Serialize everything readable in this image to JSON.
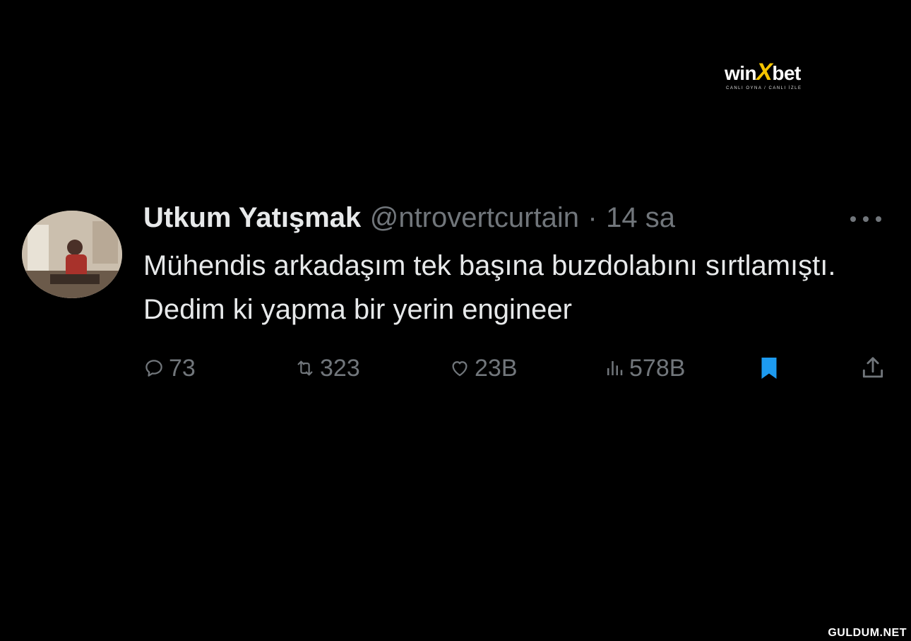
{
  "brand": {
    "logo_text": "winxbet",
    "tagline": "CANLI OYNA / CANLI İZLE"
  },
  "tweet": {
    "display_name": "Utkum Yatışmak",
    "handle": "@ntrovertcurtain",
    "separator": "·",
    "time": "14 sa",
    "more_icon": "more-horizontal-icon",
    "text": "Mühendis arkadaşım tek başına buzdolabını sırtlamıştı. Dedim ki yapma bir yerin engineer",
    "actions": {
      "replies": "73",
      "retweets": "323",
      "likes": "23B",
      "views": "578B"
    },
    "icons": {
      "reply": "reply-icon",
      "retweet": "retweet-icon",
      "like": "heart-icon",
      "views": "views-icon",
      "bookmark": "bookmark-icon",
      "share": "share-icon"
    }
  },
  "watermark": "GULDUM.NET",
  "colors": {
    "background": "#000000",
    "text_primary": "#e7e9ea",
    "text_secondary": "#71767b",
    "bookmark_active": "#1d9bf0",
    "brand_accent": "#f5c400"
  }
}
